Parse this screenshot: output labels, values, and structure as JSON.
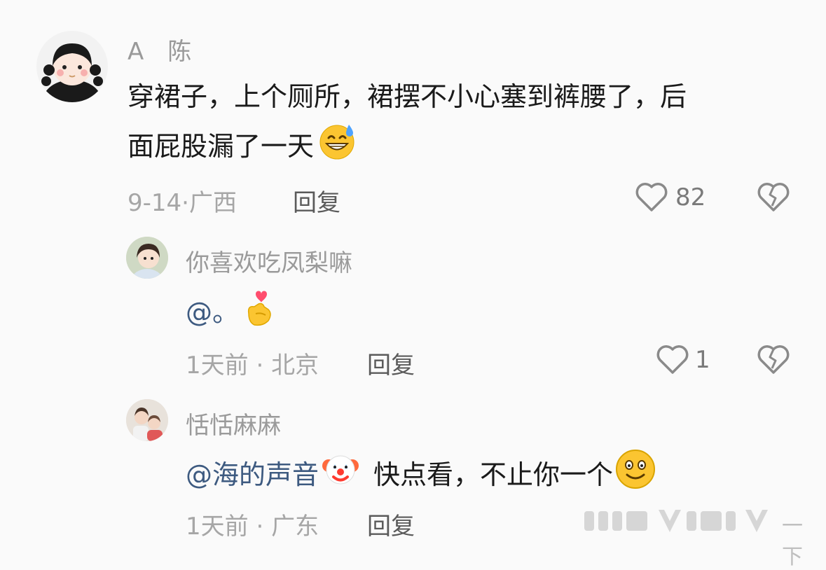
{
  "comments": [
    {
      "author": "A　陈",
      "text_line1": "穿裙子，上个厕所，裙摆不小心塞到裤腰了，后",
      "text_line2": "面屁股漏了一天",
      "emoji": "grinning-sweat-emoji",
      "date": "9-14",
      "location": "广西",
      "reply_label": "回复",
      "likes": "82"
    },
    {
      "author": "你喜欢吃凤梨嘛",
      "mention": "@。",
      "emoji": "finger-heart-emoji",
      "date": "1天前",
      "location": "北京",
      "reply_label": "回复",
      "likes": "1"
    },
    {
      "author": "恬恬麻麻",
      "mention": "@海的声音",
      "emoji": "clown-emoji",
      "text": "快点看，不止你一个",
      "emoji2": "smiley-emoji",
      "date": "1天前",
      "location": "广东",
      "reply_label": "回复"
    }
  ],
  "separator": "·",
  "watermark": "一下",
  "colors": {
    "mention": "#3d5a80",
    "meta": "#a6a6a6",
    "icon": "#8a8a8a"
  }
}
